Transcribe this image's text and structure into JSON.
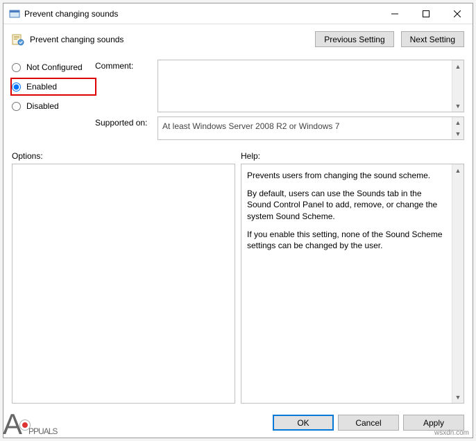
{
  "window": {
    "title": "Prevent changing sounds"
  },
  "header": {
    "setting_name": "Prevent changing sounds",
    "prev_btn": "Previous Setting",
    "next_btn": "Next Setting"
  },
  "radios": {
    "not_configured": "Not Configured",
    "enabled": "Enabled",
    "disabled": "Disabled",
    "selected": "enabled"
  },
  "labels": {
    "comment": "Comment:",
    "supported": "Supported on:",
    "options": "Options:",
    "help": "Help:"
  },
  "fields": {
    "comment_value": "",
    "supported_value": "At least Windows Server 2008 R2 or Windows 7"
  },
  "help": {
    "p1": "Prevents users from changing the sound scheme.",
    "p2": "By default, users can use the Sounds tab in the Sound Control Panel to add, remove, or change the system Sound Scheme.",
    "p3": "If you enable this setting, none of the Sound Scheme settings can be changed by the user."
  },
  "footer": {
    "ok": "OK",
    "cancel": "Cancel",
    "apply": "Apply"
  },
  "watermark": "wsxdn.com",
  "brand": "PPUALS"
}
